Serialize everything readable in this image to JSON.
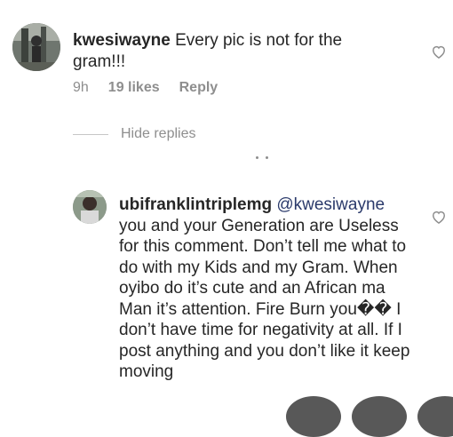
{
  "comment": {
    "username": "kwesiwayne",
    "text": " Every pic is not for the gram!!!",
    "time": "9h",
    "likes": "19 likes",
    "reply_label": "Reply",
    "hide_replies_label": "Hide replies"
  },
  "reply": {
    "username": "ubifranklintriplemg",
    "mention": "@kwesiwayne",
    "text": "you and your Generation are Useless for this comment. Don’t tell me what to do with my Kids and my Gram. When oyibo do it’s cute and an African ma Man it’s attention. Fire Burn you I don’t have time for negativity at all. If I post anything and you don’t like it keep moving",
    "text_broken_emoji": "��"
  },
  "icons": {
    "like": "heart-outline-icon",
    "avatar": "avatar"
  },
  "colors": {
    "text": "#262626",
    "muted": "#8e8e8e",
    "mention": "#2b3a6b"
  }
}
